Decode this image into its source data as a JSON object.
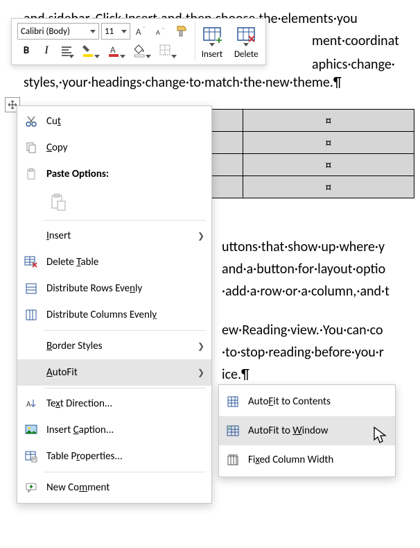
{
  "miniToolbar": {
    "fontName": "Calibri (Body)",
    "fontSize": "11",
    "boldLabel": "B",
    "italicLabel": "I",
    "insertLabel": "Insert",
    "deleteLabel": "Delete"
  },
  "document": {
    "line1": "and·sidebar.·Click·Insert·and·then·choose·the·elements·you",
    "line2": "ment·coordinat",
    "line3": "aphics·change·",
    "line4": "styles,·your·headings·change·to·match·the·new·theme.¶",
    "line5": "uttons·that·show·up·where·y",
    "line6": "and·a·button·for·layout·optio",
    "line7": "·add·a·row·or·a·column,·and·t",
    "line8": "ew·Reading·view.·You·can·co",
    "line9": "·to·stop·reading·before·you·r",
    "line10": "ice.¶",
    "cellMark": "¤"
  },
  "contextMenu": {
    "cut": "Cut",
    "copy": "Copy",
    "pasteOptions": "Paste Options:",
    "insert": "Insert",
    "deleteTable": "Delete Table",
    "distributeRows": "Distribute Rows Evenly",
    "distributeCols": "Distribute Columns Evenly",
    "borderStyles": "Border Styles",
    "autoFit": "AutoFit",
    "textDirection": "Text Direction...",
    "insertCaption": "Insert Caption...",
    "tableProperties": "Table Properties...",
    "newComment": "New Comment"
  },
  "autoFitSubmenu": {
    "toContents": "AutoFit to Contents",
    "toWindow": "AutoFit to Window",
    "fixed": "Fixed Column Width"
  },
  "colors": {
    "accent": "#2b579a",
    "highlight": "#ffd700",
    "red": "#d13438",
    "green": "#107c10"
  }
}
